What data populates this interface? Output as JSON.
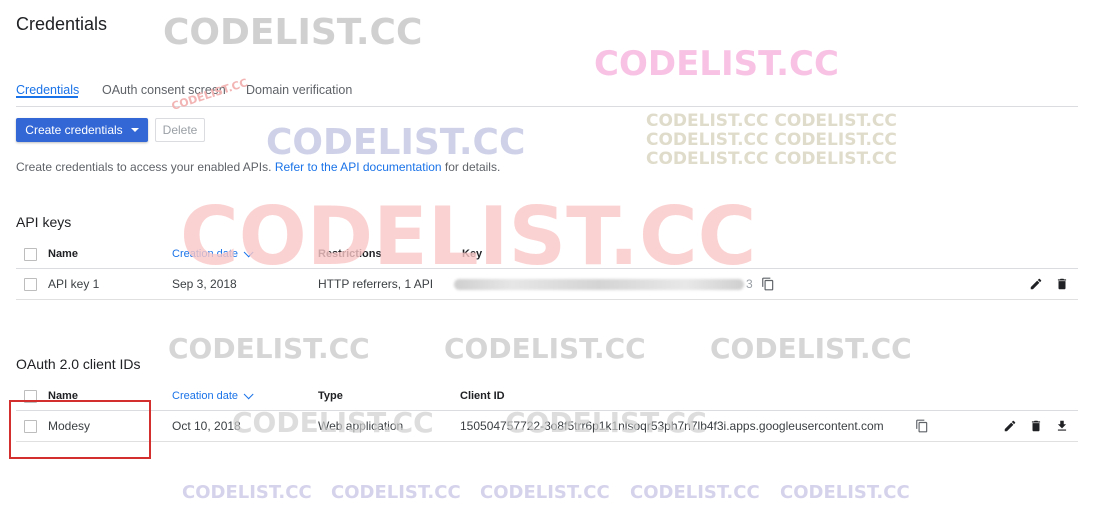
{
  "page_title": "Credentials",
  "tabs": [
    {
      "label": "Credentials",
      "active": true
    },
    {
      "label": "OAuth consent screen",
      "active": false
    },
    {
      "label": "Domain verification",
      "active": false
    }
  ],
  "toolbar": {
    "create_label": "Create credentials",
    "delete_label": "Delete"
  },
  "help": {
    "prefix": "Create credentials to access your enabled APIs. ",
    "link": "Refer to the API documentation",
    "suffix": " for details."
  },
  "api_keys": {
    "title": "API keys",
    "columns": [
      "Name",
      "Creation date",
      "Restrictions",
      "Key"
    ],
    "rows": [
      {
        "name": "API key 1",
        "date": "Sep 3, 2018",
        "restrictions": "HTTP referrers, 1 API",
        "key_visible": "3"
      }
    ]
  },
  "oauth": {
    "title": "OAuth 2.0 client IDs",
    "columns": [
      "Name",
      "Creation date",
      "Type",
      "Client ID"
    ],
    "rows": [
      {
        "name": "Modesy",
        "date": "Oct 10, 2018",
        "type": "Web application",
        "client_id": "150504757722-3o8f5trr6p1k1nlsoqr53ph7n7lb4f3i.apps.googleusercontent.com"
      }
    ]
  },
  "watermarks": {
    "text": "CODELIST.CC",
    "line_three": "CODELIST.CC CODELIST.CC",
    "small": "CODELIST.CC",
    "gray": "#c8c8c8",
    "pink": "#f7b8e0",
    "navy": "#c9cde6",
    "red": "#fbc8c8",
    "lavender": "#d5d2ec"
  },
  "icons": {
    "copy": "copy-icon",
    "edit": "pencil-icon",
    "delete": "trash-icon",
    "download": "download-icon",
    "sort": "chevron-down-icon"
  },
  "colors": {
    "accent": "#1a73e8",
    "primary_button": "#3367d6",
    "highlight": "#d32f2f"
  }
}
